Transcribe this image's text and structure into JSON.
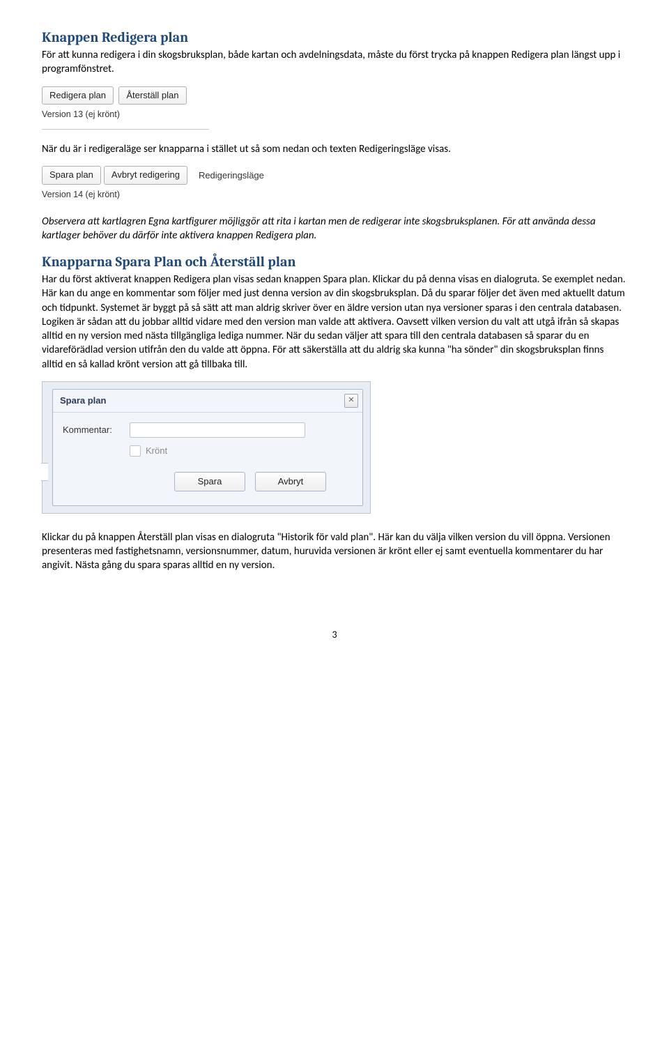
{
  "section1": {
    "heading": "Knappen Redigera plan",
    "paragraph": "För att kunna redigera i din skogsbruksplan, både kartan och avdelningsdata, måste du först trycka på knappen Redigera plan längst upp i programfönstret."
  },
  "shot1": {
    "btn_edit": "Redigera plan",
    "btn_restore": "Återställ plan",
    "status": "Version 13 (ej krönt)"
  },
  "para2": "När du är i redigeraläge ser knapparna i stället ut så som nedan och texten Redigeringsläge visas.",
  "shot2": {
    "btn_save": "Spara plan",
    "btn_cancel": "Avbryt redigering",
    "mode": "Redigeringsläge",
    "status": "Version 14 (ej krönt)"
  },
  "para3": "Observera att kartlagren Egna kartfigurer möjliggör att rita i kartan men de redigerar inte skogsbruksplanen. För att använda dessa kartlager behöver du därför inte aktivera knappen Redigera plan.",
  "section2": {
    "heading": "Knapparna Spara Plan och Återställ plan",
    "paragraph": "Har du först aktiverat knappen Redigera plan visas sedan knappen Spara plan. Klickar du på denna visas en dialogruta. Se exemplet nedan. Här kan du ange en kommentar som följer med just denna version av din skogsbruksplan. Då du sparar följer det även med aktuellt datum och tidpunkt. Systemet är byggt på så sätt att man aldrig skriver över en äldre version utan nya versioner sparas i den centrala databasen. Logiken är sådan att du jobbar alltid vidare med den version man valde att aktivera. Oavsett vilken version du valt att utgå ifrån så skapas alltid en ny version med nästa tillgängliga lediga nummer. När du sedan väljer att spara till den centrala databasen så sparar du en vidareförädlad version utifrån den du valde att öppna. För att säkerställa att du aldrig ska kunna \"ha sönder\" din skogsbruksplan finns alltid en så kallad krönt version att gå tillbaka till."
  },
  "dialog": {
    "title": "Spara plan",
    "label_comment": "Kommentar:",
    "label_check": "Krönt",
    "btn_save": "Spara",
    "btn_cancel": "Avbryt",
    "close": "✕"
  },
  "para4": "Klickar du på knappen Återställ plan visas en dialogruta \"Historik för vald plan\". Här kan du välja vilken version du vill öppna. Versionen presenteras med fastighetsnamn, versionsnummer, datum, huruvida versionen är krönt eller ej samt eventuella kommentarer du har angivit. Nästa gång du spara sparas alltid en ny version.",
  "page_number": "3"
}
